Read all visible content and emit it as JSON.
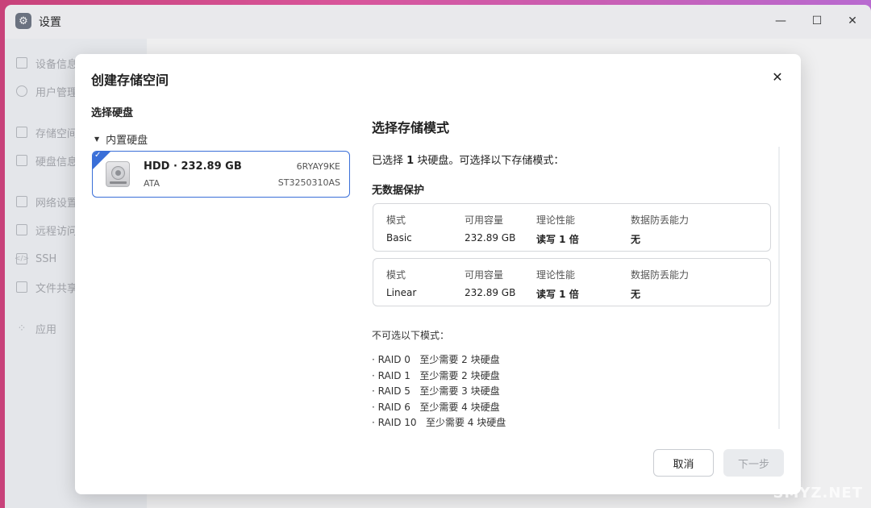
{
  "window": {
    "title": "设置",
    "controls": {
      "minimize": "—",
      "maximize": "☐",
      "close": "✕"
    }
  },
  "sidebar": {
    "items": [
      {
        "label": "设备信息",
        "icon": "device-info-icon"
      },
      {
        "label": "用户管理",
        "icon": "user-icon"
      },
      {
        "label": "存储空间",
        "icon": "storage-icon"
      },
      {
        "label": "硬盘信息",
        "icon": "disk-icon"
      },
      {
        "label": "网络设置",
        "icon": "network-icon"
      },
      {
        "label": "远程访问",
        "icon": "remote-icon"
      },
      {
        "label": "SSH",
        "icon": "ssh-icon"
      },
      {
        "label": "文件共享",
        "icon": "file-share-icon"
      },
      {
        "label": "应用",
        "icon": "apps-icon"
      }
    ]
  },
  "dialog": {
    "title": "创建存储空间",
    "close": "✕",
    "select_disk_title": "选择硬盘",
    "tree_node": "内置硬盘",
    "disk": {
      "name": "HDD · 232.89 GB",
      "interface": "ATA",
      "serial": "6RYAY9KE",
      "model": "ST3250310AS",
      "selected": true
    },
    "mode_title": "选择存储模式",
    "mode_desc_prefix": "已选择",
    "mode_desc_count": "1",
    "mode_desc_suffix": "块硬盘。可选择以下存储模式：",
    "section_label": "无数据保护",
    "headers": {
      "mode": "模式",
      "capacity": "可用容量",
      "performance": "理论性能",
      "protection": "数据防丢能力"
    },
    "modes": [
      {
        "name": "Basic",
        "capacity": "232.89 GB",
        "performance": "读写 1 倍",
        "protection": "无"
      },
      {
        "name": "Linear",
        "capacity": "232.89 GB",
        "performance": "读写 1 倍",
        "protection": "无"
      }
    ],
    "unavailable_title": "不可选以下模式：",
    "unavailable": [
      "· RAID 0   至少需要 2 块硬盘",
      "· RAID 1   至少需要 2 块硬盘",
      "· RAID 5   至少需要 3 块硬盘",
      "· RAID 6   至少需要 4 块硬盘",
      "· RAID 10   至少需要 4 块硬盘"
    ],
    "buttons": {
      "cancel": "取消",
      "next": "下一步"
    }
  },
  "watermark": "SMYZ.NET",
  "colors": {
    "accent": "#3a6fd8",
    "dialog_bg": "#ffffff",
    "sidebar_bg": "#eef0f3"
  }
}
